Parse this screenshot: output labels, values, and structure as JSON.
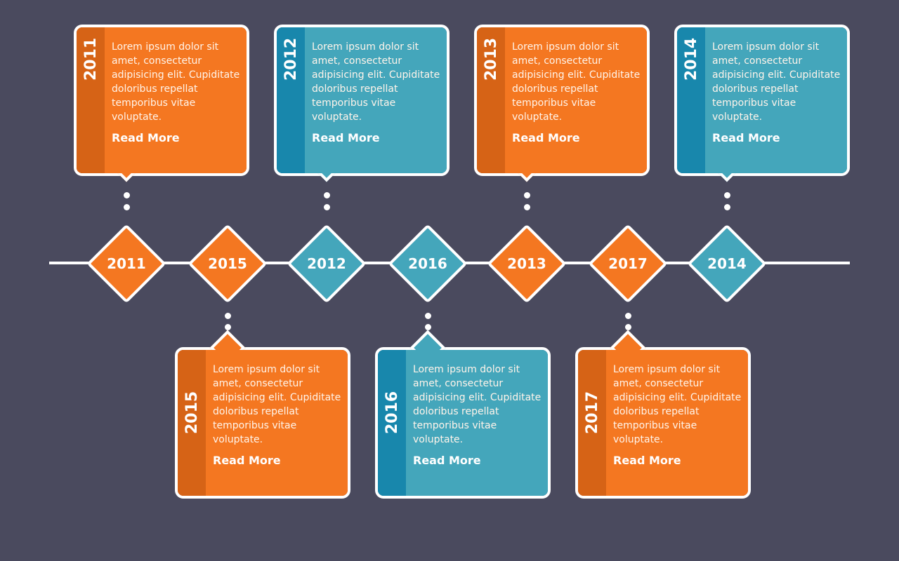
{
  "colors": {
    "background": "#4a4a5e",
    "orange": "#f47721",
    "orange_dark": "#d66316",
    "blue": "#44a6bb",
    "blue_dark": "#1887ac"
  },
  "milestones": [
    {
      "year": "2011",
      "color": "orange"
    },
    {
      "year": "2015",
      "color": "orange"
    },
    {
      "year": "2012",
      "color": "blue"
    },
    {
      "year": "2016",
      "color": "blue"
    },
    {
      "year": "2013",
      "color": "orange"
    },
    {
      "year": "2017",
      "color": "orange"
    },
    {
      "year": "2014",
      "color": "blue"
    }
  ],
  "cards": [
    {
      "year": "2011",
      "text": "Lorem ipsum dolor sit amet, consectetur adipisicing elit. Cupiditate doloribus repellat temporibus vitae voluptate.",
      "link": "Read More"
    },
    {
      "year": "2015",
      "text": "Lorem ipsum dolor sit amet, consectetur adipisicing elit. Cupiditate doloribus repellat temporibus vitae voluptate.",
      "link": "Read More"
    },
    {
      "year": "2012",
      "text": "Lorem ipsum dolor sit amet, consectetur adipisicing elit. Cupiditate doloribus repellat temporibus vitae voluptate.",
      "link": "Read More"
    },
    {
      "year": "2016",
      "text": "Lorem ipsum dolor sit amet, consectetur adipisicing elit. Cupiditate doloribus repellat temporibus vitae voluptate.",
      "link": "Read More"
    },
    {
      "year": "2013",
      "text": "Lorem ipsum dolor sit amet, consectetur adipisicing elit. Cupiditate doloribus repellat temporibus vitae voluptate.",
      "link": "Read More"
    },
    {
      "year": "2017",
      "text": "Lorem ipsum dolor sit amet, consectetur adipisicing elit. Cupiditate doloribus repellat temporibus vitae voluptate.",
      "link": "Read More"
    },
    {
      "year": "2014",
      "text": "Lorem ipsum dolor sit amet, consectetur adipisicing elit. Cupiditate doloribus repellat temporibus vitae voluptate.",
      "link": "Read More"
    }
  ]
}
